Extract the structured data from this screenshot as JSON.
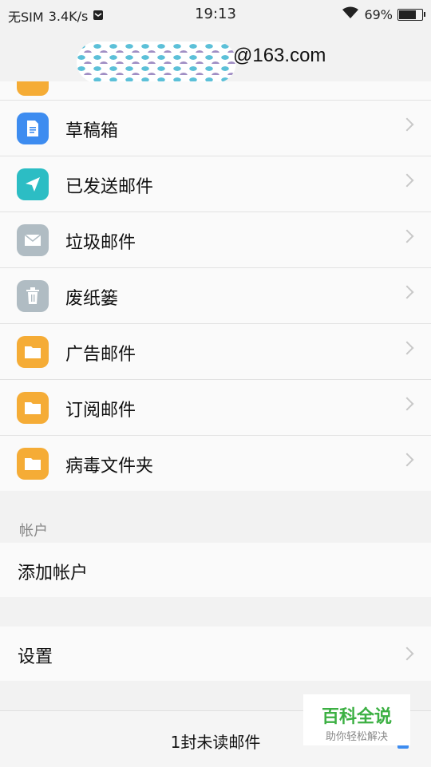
{
  "status_bar": {
    "carrier": "无SIM",
    "speed": "3.4K/s",
    "time": "19:13",
    "battery": "69%",
    "battery_level": 0.69
  },
  "header": {
    "account_suffix": "@163.com"
  },
  "folders": [
    {
      "label": "",
      "icon": "folder-icon",
      "color": "#f5ac36"
    },
    {
      "label": "草稿箱",
      "icon": "draft-icon",
      "color": "#3d8cf0"
    },
    {
      "label": "已发送邮件",
      "icon": "send-icon",
      "color": "#2cbdc4"
    },
    {
      "label": "垃圾邮件",
      "icon": "mail-icon",
      "color": "#b0bcc3"
    },
    {
      "label": "废纸篓",
      "icon": "trash-icon",
      "color": "#b0bcc3"
    },
    {
      "label": "广告邮件",
      "icon": "folder-icon",
      "color": "#f5ac36"
    },
    {
      "label": "订阅邮件",
      "icon": "folder-icon",
      "color": "#f5ac36"
    },
    {
      "label": "病毒文件夹",
      "icon": "folder-icon",
      "color": "#f5ac36"
    }
  ],
  "accounts_section": {
    "title": "帐户",
    "add_account": "添加帐户"
  },
  "settings": {
    "label": "设置"
  },
  "footer": {
    "unread": "1封未读邮件"
  },
  "watermark": {
    "title": "百科全说",
    "subtitle": "助你轻松解决"
  }
}
